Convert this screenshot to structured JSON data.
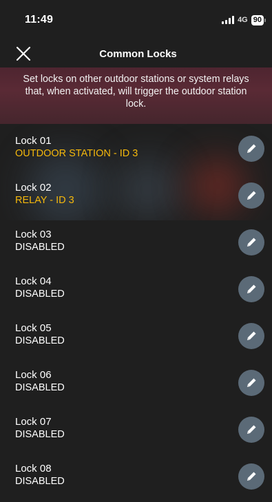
{
  "status_bar": {
    "time": "11:49",
    "network": "4G",
    "battery": "90"
  },
  "header": {
    "title": "Common Locks",
    "close_icon": "close-icon"
  },
  "banner": {
    "text": "Set locks on other outdoor stations or system relays that, when activated, will trigger the outdoor station lock."
  },
  "colors": {
    "accent": "#f5b80c",
    "edit_button": "#5b6a77",
    "banner": "#5a2a35"
  },
  "locks": [
    {
      "name": "Lock 01",
      "status": "OUTDOOR STATION - ID 3",
      "active": true
    },
    {
      "name": "Lock 02",
      "status": "RELAY - ID 3",
      "active": true
    },
    {
      "name": "Lock 03",
      "status": "DISABLED",
      "active": false
    },
    {
      "name": "Lock 04",
      "status": "DISABLED",
      "active": false
    },
    {
      "name": "Lock 05",
      "status": "DISABLED",
      "active": false
    },
    {
      "name": "Lock 06",
      "status": "DISABLED",
      "active": false
    },
    {
      "name": "Lock 07",
      "status": "DISABLED",
      "active": false
    },
    {
      "name": "Lock 08",
      "status": "DISABLED",
      "active": false
    }
  ]
}
